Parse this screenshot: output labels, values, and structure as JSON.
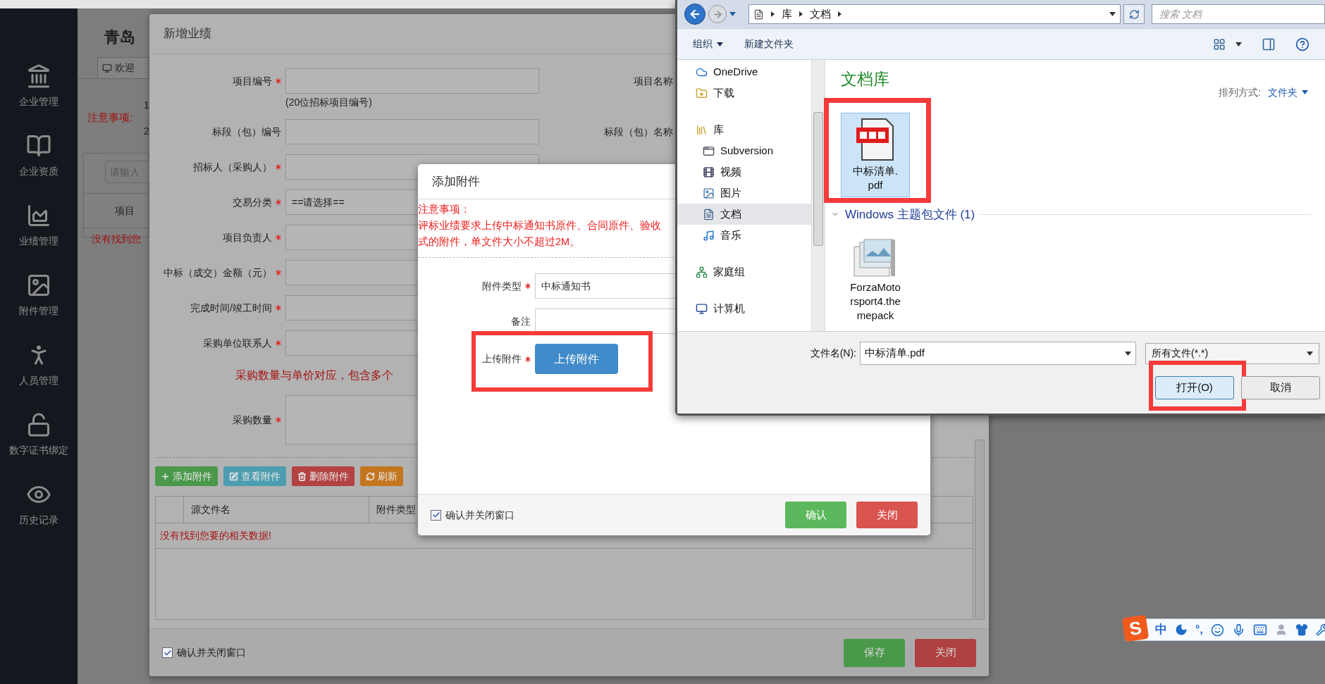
{
  "sidebar": {
    "items": [
      {
        "label": "企业管理"
      },
      {
        "label": "企业资质"
      },
      {
        "label": "业绩管理"
      },
      {
        "label": "附件管理"
      },
      {
        "label": "人员管理"
      },
      {
        "label": "数字证书绑定"
      },
      {
        "label": "历史记录"
      }
    ]
  },
  "background_page": {
    "title": "青岛",
    "tab": "欢迎",
    "notice_label": "注意事项:",
    "notice_lines": [
      "1",
      "2"
    ],
    "search_placeholder": "请输入",
    "table_column": "项目",
    "empty_message": "没有找到您"
  },
  "performance_dialog": {
    "title": "新增业绩",
    "fields": [
      {
        "kind": "input",
        "label": "项目编号",
        "required": true,
        "hint": "(20位招标项目编号)",
        "side_label": "项目名称"
      },
      {
        "kind": "input",
        "label": "标段（包）编号",
        "side_label": "标段（包）名称"
      },
      {
        "kind": "input",
        "label": "招标人（采购人）",
        "required": true
      },
      {
        "kind": "select",
        "label": "交易分类",
        "required": true,
        "value": "==请选择=="
      },
      {
        "kind": "input",
        "label": "项目负责人",
        "required": true
      },
      {
        "kind": "input",
        "label": "中标（成交）金额（元）",
        "required": true
      },
      {
        "kind": "input",
        "label": "完成时间/竣工时间",
        "required": true
      },
      {
        "kind": "input",
        "label": "采购单位联系人",
        "required": true
      },
      {
        "kind": "note",
        "label": "采购数量与单价对应，包含多个"
      },
      {
        "kind": "textarea",
        "label": "采购数量",
        "required": true
      }
    ],
    "attachment_toolbar": [
      {
        "kind": "add",
        "label": "添加附件"
      },
      {
        "kind": "view",
        "label": "查看附件"
      },
      {
        "kind": "delete",
        "label": "删除附件"
      },
      {
        "kind": "refresh",
        "label": "刷新"
      }
    ],
    "attachment_table": {
      "columns": [
        "源文件名",
        "附件类型"
      ],
      "empty_message": "没有找到您要的相关数据!"
    },
    "confirm_close": {
      "label": "确认并关闭窗口",
      "checked": true
    },
    "buttons": [
      {
        "kind": "save",
        "label": "保存"
      },
      {
        "kind": "close",
        "label": "关闭"
      }
    ]
  },
  "attachment_dialog": {
    "title": "添加附件",
    "notice_lines": [
      "注意事项：",
      "评标业绩要求上传中标通知书原件、合同原件、验收",
      "式的附件，单文件大小不超过2M。"
    ],
    "fields": [
      {
        "kind": "input",
        "label": "附件类型",
        "required": true,
        "value": "中标通知书"
      },
      {
        "kind": "input",
        "label": "备注"
      },
      {
        "kind": "upload",
        "label": "上传附件",
        "required": true,
        "button": "上传附件",
        "highlighted": true
      }
    ],
    "confirm_close": {
      "label": "确认并关闭窗口",
      "checked": true
    },
    "buttons": [
      {
        "kind": "confirm",
        "label": "确认"
      },
      {
        "kind": "close",
        "label": "关闭"
      }
    ]
  },
  "file_dialog": {
    "breadcrumb": [
      "库",
      "文档"
    ],
    "search_placeholder": "搜索 文档",
    "toolbar": [
      "组织",
      "新建文件夹"
    ],
    "nav": [
      {
        "kind": "cloud",
        "label": "OneDrive",
        "selected": false
      },
      {
        "kind": "download",
        "label": "下载",
        "selected": false
      },
      {
        "kind": "library",
        "label": "库",
        "selected": false,
        "children": [
          {
            "kind": "app",
            "label": "Subversion",
            "selected": false
          },
          {
            "kind": "video",
            "label": "视频",
            "selected": false
          },
          {
            "kind": "picture",
            "label": "图片",
            "selected": false
          },
          {
            "kind": "document",
            "label": "文档",
            "selected": true
          },
          {
            "kind": "music",
            "label": "音乐",
            "selected": false
          }
        ]
      },
      {
        "kind": "homegroup",
        "label": "家庭组",
        "selected": false
      },
      {
        "kind": "computer",
        "label": "计算机",
        "selected": false
      }
    ],
    "library_title": "文档库",
    "sort_label": "排列方式:",
    "sort_value": "文件夹",
    "files": [
      {
        "kind": "pdf",
        "name": "中标清单.pdf",
        "selected": true,
        "highlighted": true
      }
    ],
    "groups": [
      {
        "title": "Windows 主题包文件 (1)",
        "files": [
          {
            "kind": "package",
            "name": "ForzaMotorsport4.themepack",
            "selected": false
          }
        ]
      }
    ],
    "filename_label": "文件名(N):",
    "filename": "中标清单.pdf",
    "filter": "所有文件(*.*)",
    "buttons": [
      {
        "kind": "open",
        "label": "打开(O)",
        "highlighted": true
      },
      {
        "kind": "cancel",
        "label": "取消"
      }
    ]
  },
  "ime_toolbar": {
    "logo": "S",
    "items": [
      "中",
      "°,"
    ]
  }
}
